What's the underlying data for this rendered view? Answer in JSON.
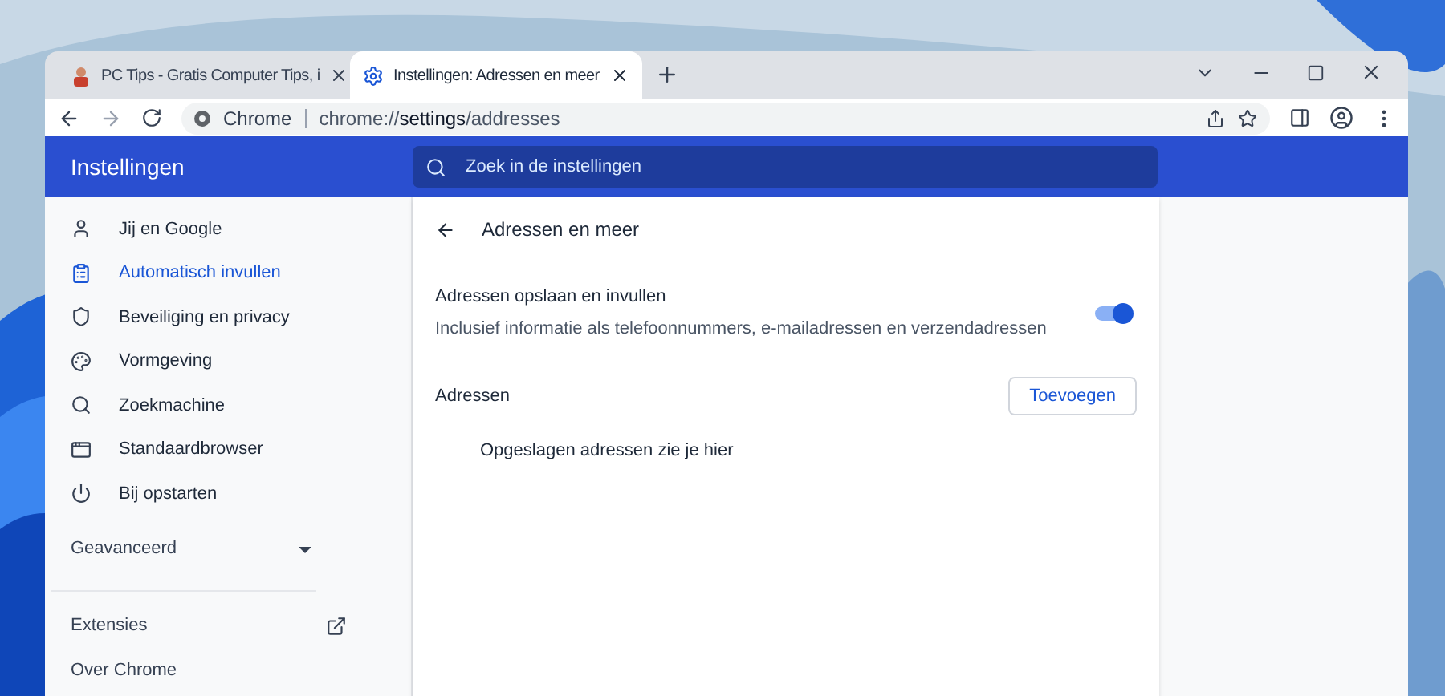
{
  "tabs": [
    {
      "title": "PC Tips - Gratis Computer Tips, i",
      "kind": "site",
      "selected": false
    },
    {
      "title": "Instellingen: Adressen en meer",
      "kind": "settings",
      "selected": true
    }
  ],
  "address_bar": {
    "site_label": "Chrome",
    "url_plain": "chrome://",
    "url_bold": "settings",
    "url_rest": "/addresses"
  },
  "header": {
    "title": "Instellingen",
    "search_placeholder": "Zoek in de instellingen"
  },
  "sidebar": {
    "items": [
      {
        "label": "Jij en Google",
        "kind": "person",
        "selected": false
      },
      {
        "label": "Automatisch invullen",
        "kind": "clipboard",
        "selected": true
      },
      {
        "label": "Beveiliging en privacy",
        "kind": "shield",
        "selected": false
      },
      {
        "label": "Vormgeving",
        "kind": "palette",
        "selected": false
      },
      {
        "label": "Zoekmachine",
        "kind": "search",
        "selected": false
      },
      {
        "label": "Standaardbrowser",
        "kind": "browser",
        "selected": false
      },
      {
        "label": "Bij opstarten",
        "kind": "power",
        "selected": false
      }
    ],
    "advanced": {
      "label": "Geavanceerd",
      "expanded": false
    },
    "links": [
      {
        "label": "Extensies",
        "external": true
      },
      {
        "label": "Over Chrome",
        "external": false
      }
    ]
  },
  "page": {
    "title": "Adressen en meer",
    "setting": {
      "title": "Adressen opslaan en invullen",
      "description": "Inclusief informatie als telefoonnummers, e-mailadressen en verzendadressen",
      "on": true
    },
    "section_title": "Adressen",
    "add_button": "Toevoegen",
    "empty_text": "Opgeslagen adressen zie je hier"
  }
}
